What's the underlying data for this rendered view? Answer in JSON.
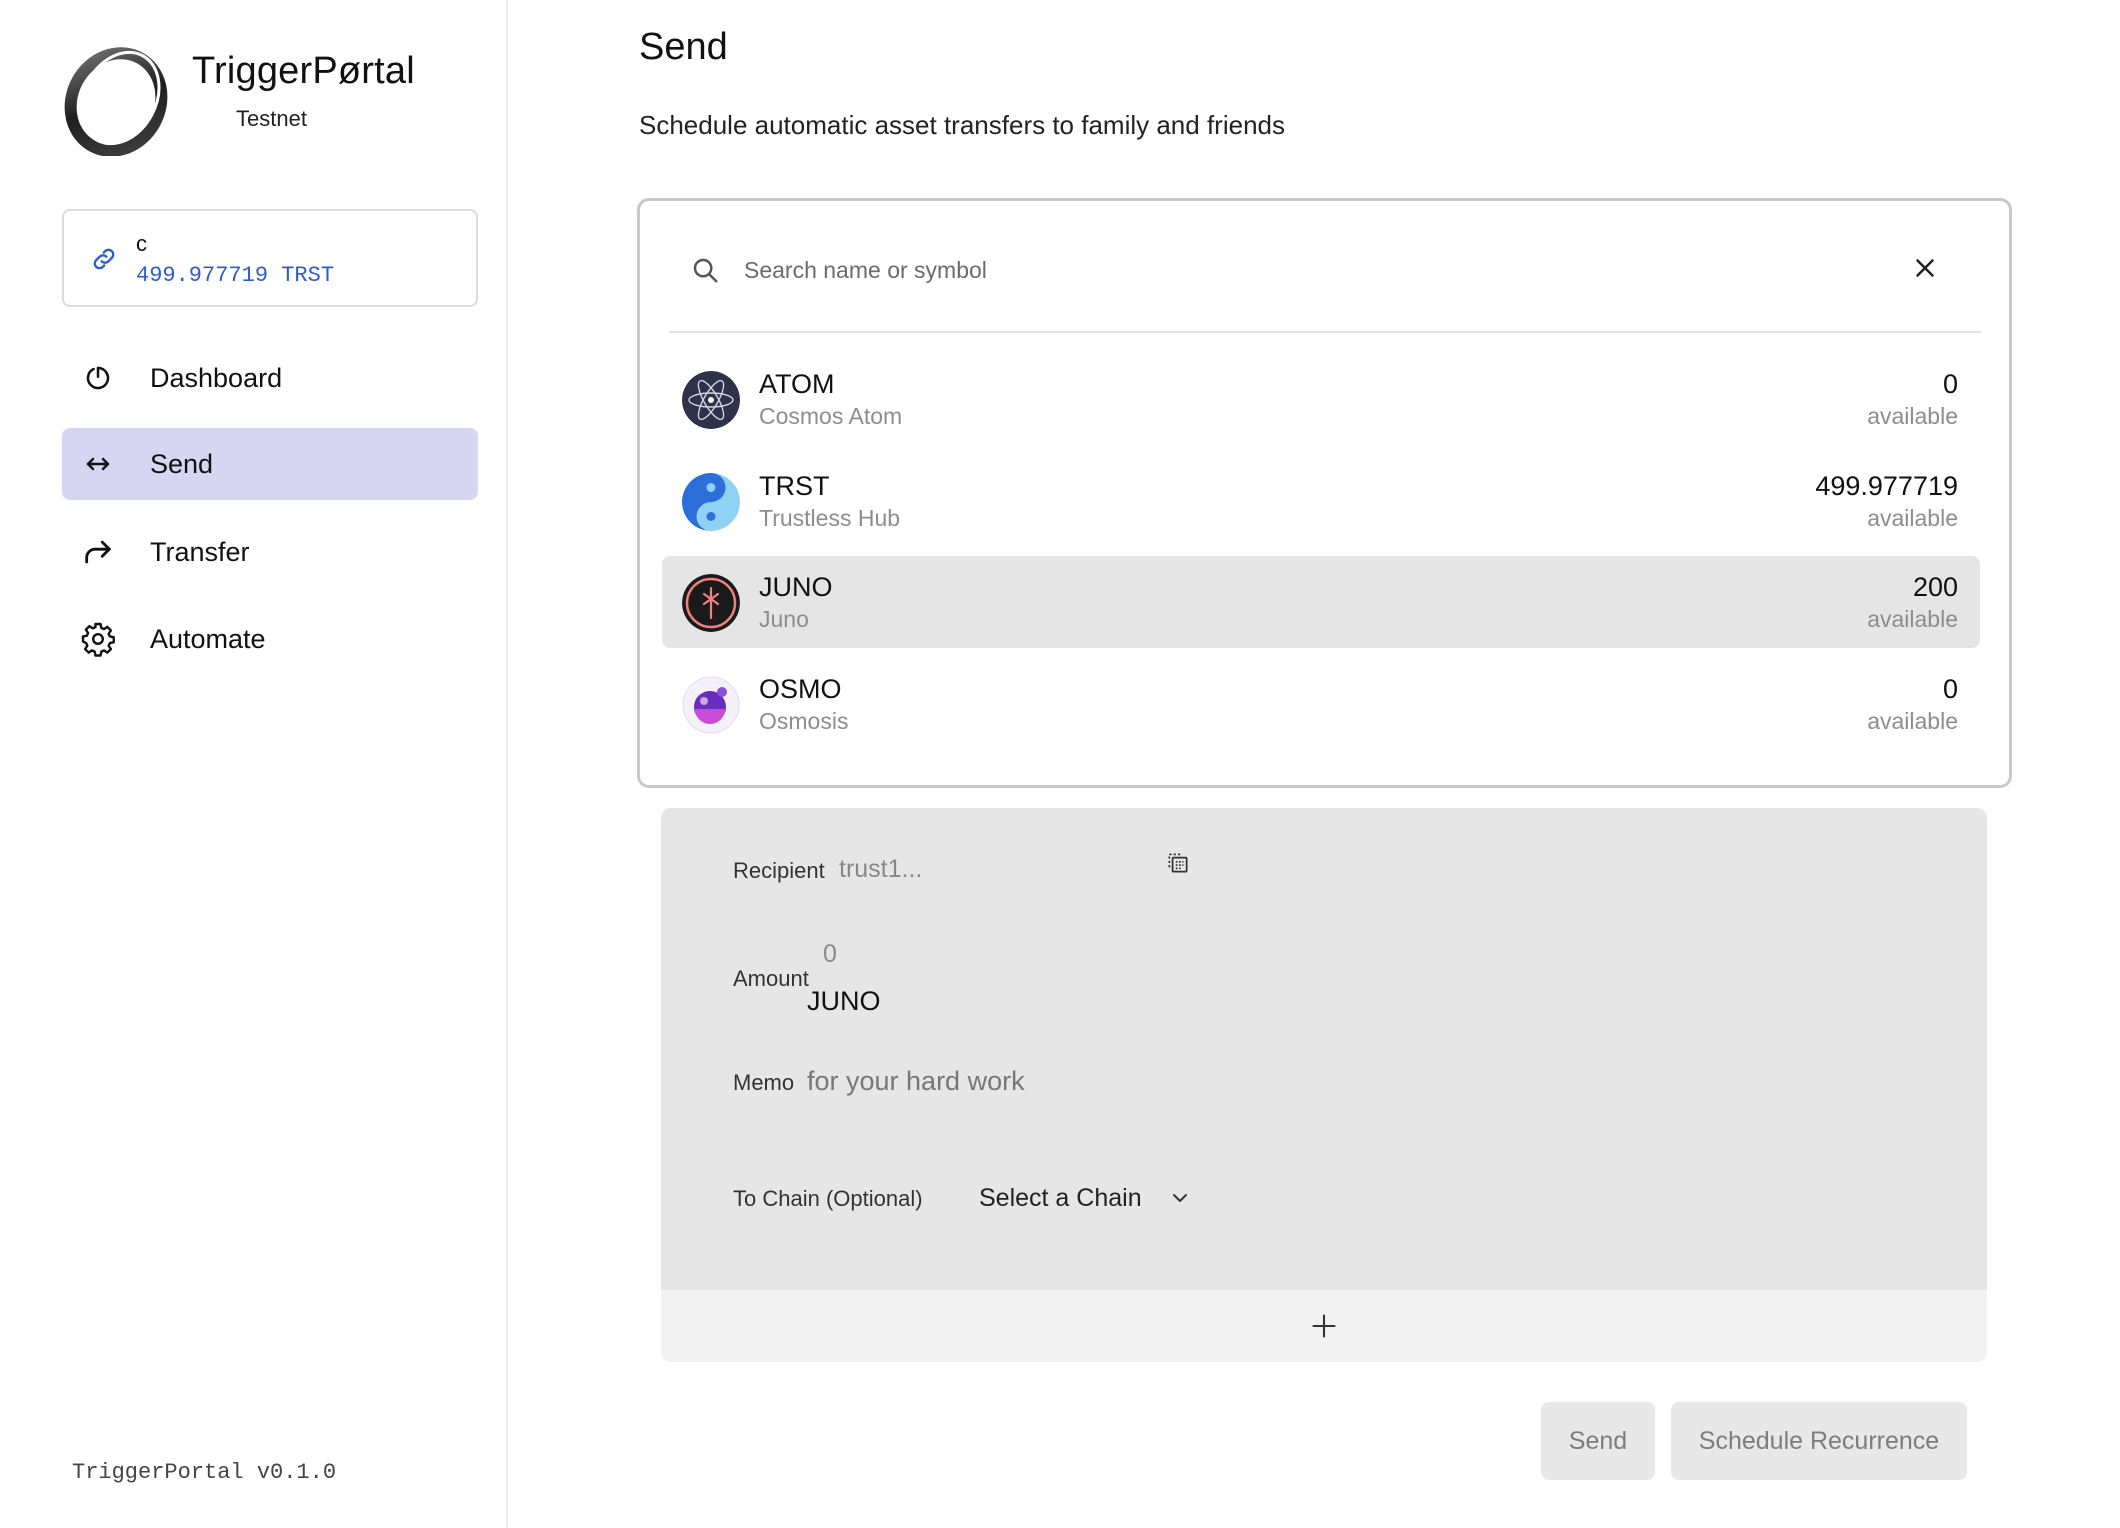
{
  "app": {
    "title": "TriggerPørtal",
    "network": "Testnet",
    "version": "TriggerPortal v0.1.0"
  },
  "wallet": {
    "name": "c",
    "balance": "499.977719 TRST"
  },
  "nav": {
    "items": [
      {
        "label": "Dashboard",
        "icon": "power-icon",
        "active": false
      },
      {
        "label": "Send",
        "icon": "arrows-left-right-icon",
        "active": true
      },
      {
        "label": "Transfer",
        "icon": "forward-arrow-icon",
        "active": false
      },
      {
        "label": "Automate",
        "icon": "gear-icon",
        "active": false
      }
    ]
  },
  "page": {
    "title": "Send",
    "subtitle": "Schedule automatic asset transfers to family and friends"
  },
  "asset_picker": {
    "search_placeholder": "Search name or symbol",
    "assets": [
      {
        "symbol": "ATOM",
        "name": "Cosmos Atom",
        "amount": "0",
        "available_label": "available",
        "selected": false
      },
      {
        "symbol": "TRST",
        "name": "Trustless Hub",
        "amount": "499.977719",
        "available_label": "available",
        "selected": false
      },
      {
        "symbol": "JUNO",
        "name": "Juno",
        "amount": "200",
        "available_label": "available",
        "selected": true
      },
      {
        "symbol": "OSMO",
        "name": "Osmosis",
        "amount": "0",
        "available_label": "available",
        "selected": false
      }
    ]
  },
  "form": {
    "recipient_label": "Recipient",
    "recipient_placeholder": "trust1...",
    "amount_label": "Amount",
    "amount_placeholder": "0",
    "amount_unit": "JUNO",
    "memo_label": "Memo",
    "memo_placeholder": "for your hard work",
    "chain_label": "To Chain (Optional)",
    "chain_select": "Select a Chain"
  },
  "actions": {
    "send": "Send",
    "schedule": "Schedule Recurrence"
  },
  "colors": {
    "accent_nav": "#d6d6f2",
    "wallet_balance": "#2a5bd0",
    "selected_row": "#e5e5e5"
  }
}
